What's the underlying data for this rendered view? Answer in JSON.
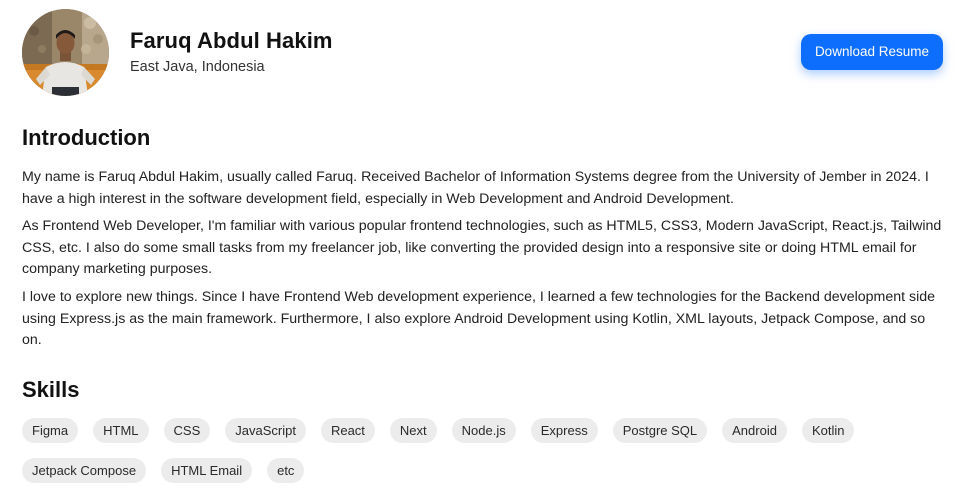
{
  "profile": {
    "name": "Faruq Abdul Hakim",
    "location": "East Java, Indonesia"
  },
  "header": {
    "download_label": "Download Resume"
  },
  "introduction": {
    "title": "Introduction",
    "paragraphs": [
      "My name is Faruq Abdul Hakim, usually called Faruq. Received Bachelor of Information Systems degree from the University of Jember in 2024. I have a high interest in the software development field, especially in Web Development and Android Development.",
      "As Frontend Web Developer, I'm familiar with various popular frontend technologies, such as HTML5, CSS3, Modern JavaScript, React.js, Tailwind CSS, etc. I also do some small tasks from my freelancer job, like converting the provided design into a responsive site or doing HTML email for company marketing purposes.",
      "I love to explore new things. Since I have Frontend Web development experience, I learned a few technologies for the Backend development side using Express.js as the main framework. Furthermore, I also explore Android Development using Kotlin, XML layouts, Jetpack Compose, and so on."
    ]
  },
  "skills": {
    "title": "Skills",
    "items": [
      "Figma",
      "HTML",
      "CSS",
      "JavaScript",
      "React",
      "Next",
      "Node.js",
      "Express",
      "Postgre SQL",
      "Android",
      "Kotlin",
      "Jetpack Compose",
      "HTML Email",
      "etc"
    ]
  },
  "colors": {
    "accent": "#0d6efd",
    "chip_bg": "#ececec"
  }
}
